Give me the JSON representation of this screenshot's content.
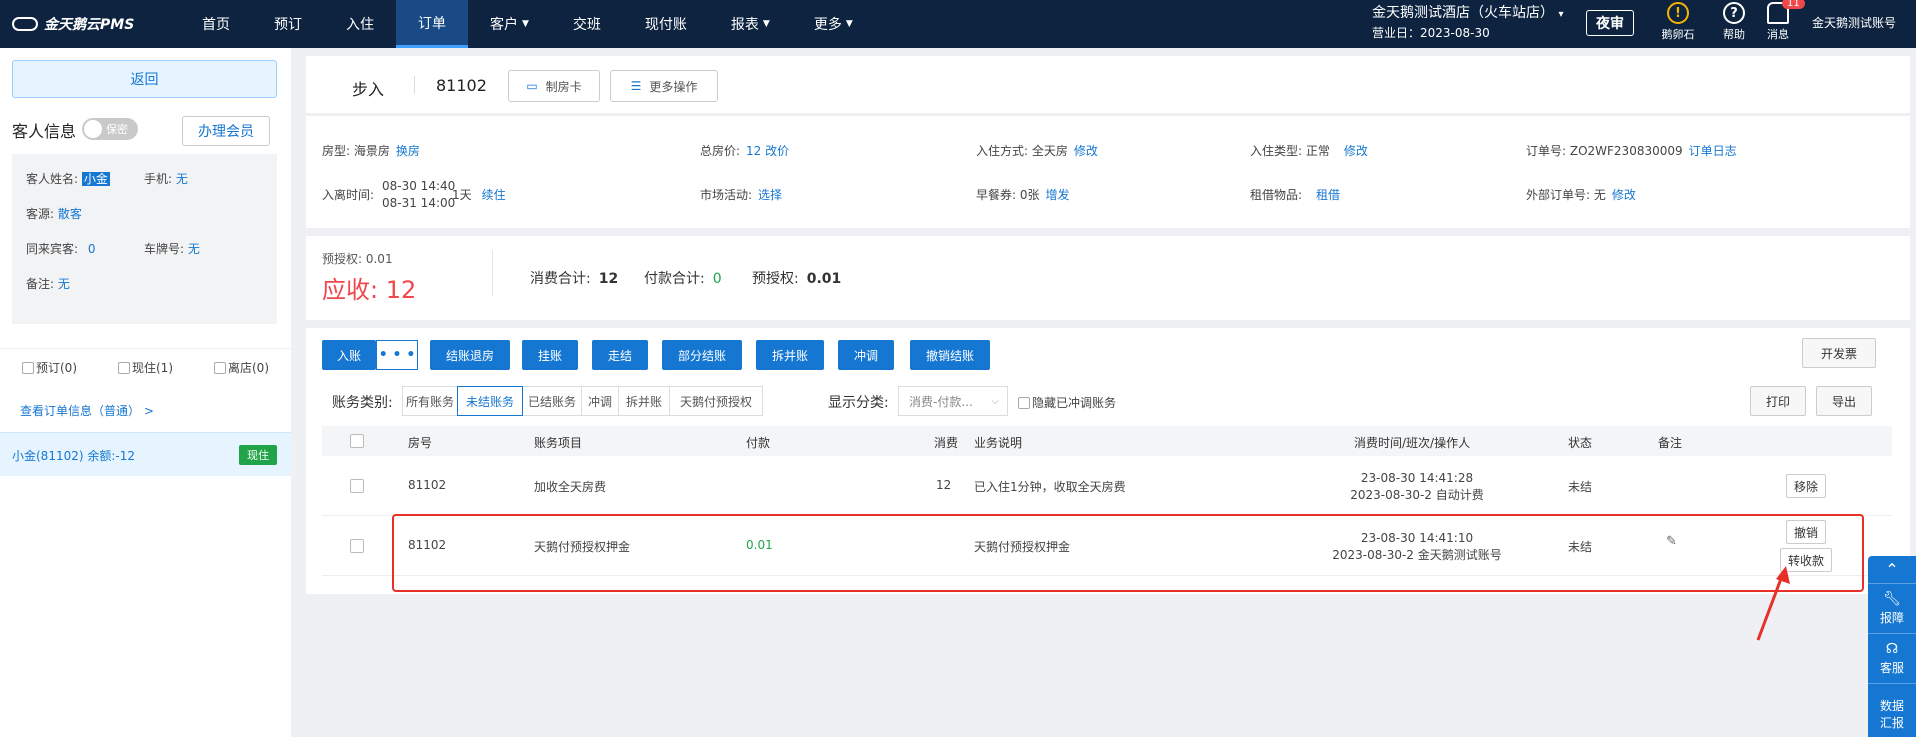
{
  "app": {
    "logo": "金天鹅云PMS",
    "nav": [
      {
        "label": "首页",
        "caret": false,
        "active": false
      },
      {
        "label": "预订",
        "caret": false,
        "active": false
      },
      {
        "label": "入住",
        "caret": false,
        "active": false
      },
      {
        "label": "订单",
        "caret": false,
        "active": true
      },
      {
        "label": "客户",
        "caret": true,
        "active": false
      },
      {
        "label": "交班",
        "caret": false,
        "active": false
      },
      {
        "label": "现付账",
        "caret": false,
        "active": false
      },
      {
        "label": "报表",
        "caret": true,
        "active": false
      },
      {
        "label": "更多",
        "caret": true,
        "active": false
      }
    ],
    "hotel_name": "金天鹅测试酒店（火车站店）",
    "business_day": "营业日：2023-08-30",
    "night_audit": "夜审",
    "egg_stone": "鹅卵石",
    "help": "帮助",
    "messages": "消息",
    "messages_badge": "11",
    "account": "金天鹅测试账号"
  },
  "left": {
    "back": "返回",
    "guest_info": "客人信息",
    "secret": "保密",
    "member": "办理会员",
    "guest_name_label": "客人姓名:",
    "guest_name": "小金",
    "phone_label": "手机:",
    "phone": "无",
    "source_label": "客源:",
    "source": "散客",
    "companions_label": "同来宾客:",
    "companions": "0",
    "plate_label": "车牌号:",
    "plate": "无",
    "remark_label": "备注:",
    "remark": "无",
    "filters": [
      "预订(0)",
      "现住(1)",
      "离店(0)"
    ],
    "view_link": "查看订单信息（普通） >",
    "guest_row_name": "小金(81102)  余额:-12",
    "guest_row_tag": "现住"
  },
  "header": {
    "room_type": "步入",
    "room_no": "81102",
    "make_card": "制房卡",
    "more_ops": "更多操作"
  },
  "info": {
    "room_type_label": "房型: 海景房",
    "room_type_link": "换房",
    "total_price_label": "总房价:",
    "total_price_link": "12 改价",
    "checkin_method_label": "入住方式: 全天房",
    "checkin_method_link": "修改",
    "checkin_type_label": "入住类型: 正常",
    "checkin_type_link": "修改",
    "order_no_label": "订单号: ZO2WF230830009",
    "order_no_link": "订单日志",
    "stay_time_label": "入离时间:",
    "stay_in": "08-30 14:40",
    "stay_out": "08-31 14:00",
    "stay_days": "1天",
    "stay_link": "续住",
    "market_label": "市场活动:",
    "market_link": "选择",
    "breakfast_label": "早餐券: 0张",
    "breakfast_link": "增发",
    "rental_label": "租借物品:",
    "rental_link": "租借",
    "ext_order_label": "外部订单号: 无",
    "ext_order_link": "修改"
  },
  "money": {
    "pre_auth": "预授权: 0.01",
    "due": "应收: 12",
    "consume_label": "消费合计:",
    "consume": "12",
    "pay_label": "付款合计:",
    "pay": "0",
    "preauth_label": "预授权:",
    "preauth": "0.01"
  },
  "bill": {
    "post": "入账",
    "more": "• • •",
    "actions": [
      "结账退房",
      "挂账",
      "走结",
      "部分结账",
      "拆并账",
      "冲调",
      "撤销结账"
    ],
    "invoice": "开发票",
    "category_label": "账务类别:",
    "categories": [
      "所有账务",
      "未结账务",
      "已结账务",
      "冲调",
      "拆并账",
      "天鹅付预授权"
    ],
    "display_label": "显示分类:",
    "display_value": "消费-付款...",
    "hide_adjust": "隐藏已冲调账务",
    "print": "打印",
    "export": "导出",
    "columns": [
      "房号",
      "账务项目",
      "付款",
      "消费",
      "业务说明",
      "消费时间/班次/操作人",
      "状态",
      "备注"
    ],
    "rows": [
      {
        "room": "81102",
        "item": "加收全天房费",
        "pay": "",
        "consume": "12",
        "desc": "已入住1分钟，收取全天房费",
        "time1": "23-08-30 14:41:28",
        "time2": "2023-08-30-2 自动计费",
        "status": "未结",
        "actions": [
          "移除"
        ]
      },
      {
        "room": "81102",
        "item": "天鹅付预授权押金",
        "pay": "0.01",
        "consume": "",
        "desc": "天鹅付预授权押金",
        "time1": "23-08-30 14:41:10",
        "time2": "2023-08-30-2 金天鹅测试账号",
        "status": "未结",
        "actions": [
          "撤销",
          "转收款"
        ]
      }
    ]
  },
  "float": {
    "report": "报障",
    "service": "客服",
    "data1": "数据",
    "data2": "汇报"
  },
  "colors": {
    "nav_bg": "#0d2340",
    "accent": "#1677d2",
    "due": "#f0474c",
    "green": "#21a348",
    "highlight": "#e8302a"
  }
}
